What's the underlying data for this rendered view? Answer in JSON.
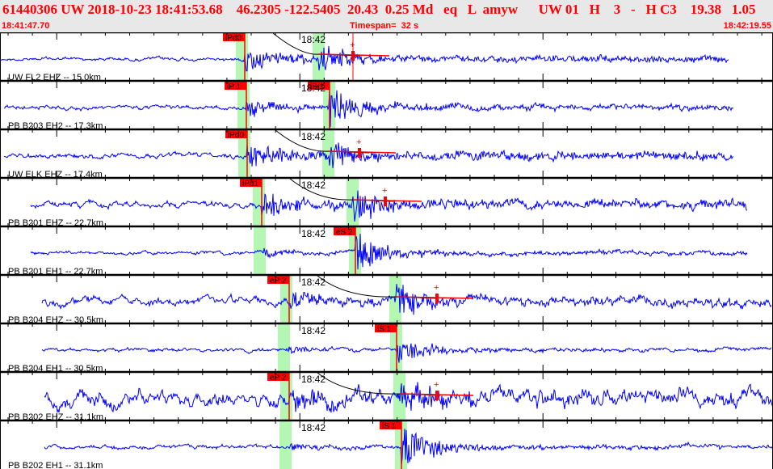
{
  "header": {
    "title": "61440306 UW 2018-10-23 18:41:53.68    46.2305 -122.5405  20.43  0.25 Md   eq   L  amyw      UW 01   H    3   -   H C3    19.38   1.05",
    "start_time": "18:41:47.70",
    "timespan": "Timespan=  32 s",
    "end_time": "18:42:19.55"
  },
  "colors": {
    "trace": "#0000ff",
    "pick": "#ff0000",
    "window": "#b3f7b3",
    "header_text": "#ff0000"
  },
  "time_axis_label": "18:42",
  "channels": [
    {
      "label": "UW FL2 EHZ -- 15.0km",
      "picks": [
        {
          "label": "iPd0",
          "phase": "P"
        }
      ],
      "p_window": true,
      "s_window": true,
      "amp_marker": true
    },
    {
      "label": "PB B203 EH2 -- 17.3km",
      "picks": [
        {
          "label": "iP 1",
          "phase": "P"
        },
        {
          "label": "iS 1",
          "phase": "S"
        }
      ],
      "p_window": true,
      "s_window": true,
      "amp_marker": false
    },
    {
      "label": "UW ELK EHZ -- 17.4km",
      "picks": [
        {
          "label": "iPd0",
          "phase": "P"
        }
      ],
      "p_window": true,
      "s_window": true,
      "amp_marker": true
    },
    {
      "label": "PB B201 EHZ -- 22.7km",
      "picks": [
        {
          "label": "iPd1",
          "phase": "P"
        }
      ],
      "p_window": true,
      "s_window": true,
      "amp_marker": true
    },
    {
      "label": "PB B201 EH1 -- 22.7km",
      "picks": [
        {
          "label": "eS 2",
          "phase": "S"
        }
      ],
      "p_window": true,
      "s_window": true,
      "amp_marker": false
    },
    {
      "label": "PB B204 EHZ -- 30.5km",
      "picks": [
        {
          "label": "eP 2",
          "phase": "P"
        }
      ],
      "p_window": true,
      "s_window": true,
      "amp_marker": true
    },
    {
      "label": "PB B204 EH1 -- 30.5km",
      "picks": [
        {
          "label": "iS 1",
          "phase": "S"
        }
      ],
      "p_window": true,
      "s_window": true,
      "amp_marker": false
    },
    {
      "label": "PB B202 EHZ -- 31.1km",
      "picks": [
        {
          "label": "eP 2",
          "phase": "P"
        }
      ],
      "p_window": true,
      "s_window": true,
      "amp_marker": true
    },
    {
      "label": "PB B202 EH1 -- 31.1km",
      "picks": [
        {
          "label": "iS 1",
          "phase": "S"
        }
      ],
      "p_window": true,
      "s_window": true,
      "amp_marker": false
    }
  ]
}
